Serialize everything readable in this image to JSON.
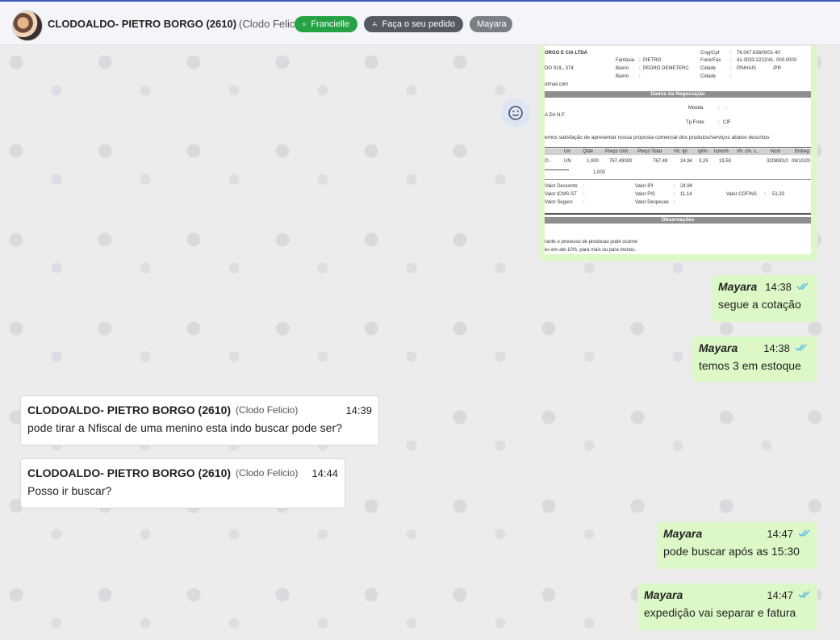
{
  "header": {
    "contact_name": "CLODOALDO- PIETRO BORGO (2610)",
    "contact_sub": "(Clodo Felicio)",
    "chips": {
      "whatsapp": "Francielle",
      "order": "Faça o seu pedido",
      "agent": "Mayara"
    }
  },
  "attachment": {
    "company": "ORGO E CIA LTDA",
    "address": "DO SUL, 374",
    "email": "otmail.com",
    "fantasia_label": "Fantasia",
    "fantasia": "PIETRO",
    "bairro_label": "Bairro",
    "bairro": "PEDRO DEMETERC",
    "bairro2_label": "Bairro",
    "cnpj_label": "Cnpj/Cpf",
    "cnpj": "76.047.638/0001-40",
    "fone_label": "Fone/Fax",
    "fone": "41-3033.2222/41- 000.0000",
    "cidade_label": "Cidade",
    "cidade": "PINHAIS",
    "uf": "/PR",
    "cidade2_label": "Cidade",
    "negociacao_title": "Dados da Negociação",
    "moeda_label": "Moeda",
    "moeda": "-",
    "nf_text": "A DA N.F.",
    "frete_label": "Tp.Frete",
    "frete": "CIF",
    "proposal_text": "emos satisfação de apresentar nossa proposta comercial dos produtos/serviços abaixo descritos",
    "table_headers": [
      "Un",
      "Qtde",
      "Preço Unit",
      "Preço Total",
      "Vlr. Ipi",
      "Ipi%",
      "Icms%",
      "Vlr. Un. L.",
      "Ncm",
      "Entreg"
    ],
    "row": [
      "O -",
      "UN",
      "1,000",
      "767,49000",
      "767,49",
      "24,94",
      "3,25",
      "19,50",
      "32089010",
      "09/10/20"
    ],
    "qty_total": "1,000",
    "desconto_label": "Valor Desconto",
    "icms_label": "Valor ICMS-ST",
    "seguro_label": "Valor Seguro",
    "ipi_label": "Valor IPI",
    "ipi": "24,94",
    "pis_label": "Valor PIS",
    "pis": "11,14",
    "despesas_label": "Valor Despesas",
    "cofins_label": "Valor COFINS",
    "cofins": "51,33",
    "obs_title": "Observações",
    "obs_line1": "rante o processo de producao pode ocorrer",
    "obs_line2": "es em ate 10%, para mais ou para menos."
  },
  "messages": [
    {
      "sender": "Mayara",
      "time": "14:38",
      "text": "segue a cotação"
    },
    {
      "sender": "Mayara",
      "time": "14:38",
      "text": "temos 3 em estoque"
    },
    {
      "sender": "CLODOALDO- PIETRO BORGO (2610)",
      "sub": "(Clodo Felicio)",
      "time": "14:39",
      "text": "pode tirar a Nfiscal de uma menino esta indo buscar pode ser?"
    },
    {
      "sender": "CLODOALDO- PIETRO BORGO (2610)",
      "sub": "(Clodo Felicio)",
      "time": "14:44",
      "text": "Posso ir buscar?"
    },
    {
      "sender": "Mayara",
      "time": "14:47",
      "text": "pode buscar após as 15:30"
    },
    {
      "sender": "Mayara",
      "time": "14:47",
      "text": "expedição vai separar e fatura"
    }
  ],
  "colors": {
    "outgoing_bubble": "#dcf8c6",
    "incoming_bubble": "#ffffff",
    "read_ticks": "#4fb6ec",
    "whatsapp_chip": "#25a244"
  }
}
